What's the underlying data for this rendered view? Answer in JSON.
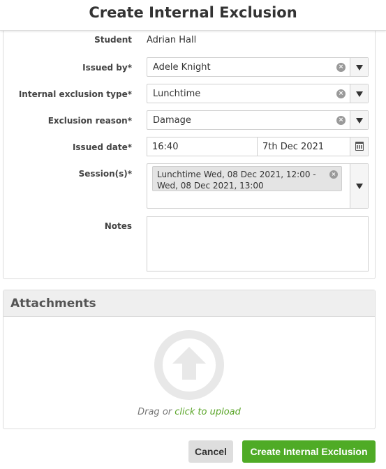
{
  "dialog": {
    "title": "Create Internal Exclusion"
  },
  "form": {
    "student": {
      "label": "Student",
      "value": "Adrian Hall"
    },
    "issued_by": {
      "label": "Issued by*",
      "value": "Adele Knight"
    },
    "exclusion_type": {
      "label": "Internal exclusion type*",
      "value": "Lunchtime"
    },
    "exclusion_reason": {
      "label": "Exclusion reason*",
      "value": "Damage"
    },
    "issued_date": {
      "label": "Issued date*",
      "time": "16:40",
      "date": "7th Dec 2021"
    },
    "sessions": {
      "label": "Session(s)*",
      "selected": [
        "Lunchtime Wed, 08 Dec 2021, 12:00 - Wed, 08 Dec 2021, 13:00"
      ]
    },
    "notes": {
      "label": "Notes",
      "value": ""
    }
  },
  "attachments": {
    "title": "Attachments",
    "drag_text": "Drag or ",
    "upload_link": "click to upload"
  },
  "buttons": {
    "cancel": "Cancel",
    "create": "Create Internal Exclusion"
  },
  "icons": {
    "clear": "clear-x-icon",
    "dropdown": "triangle-down-icon",
    "calendar": "calendar-icon",
    "upload": "upload-arrow-icon"
  },
  "colors": {
    "primary_button": "#4fab26",
    "link": "#5aa528"
  }
}
